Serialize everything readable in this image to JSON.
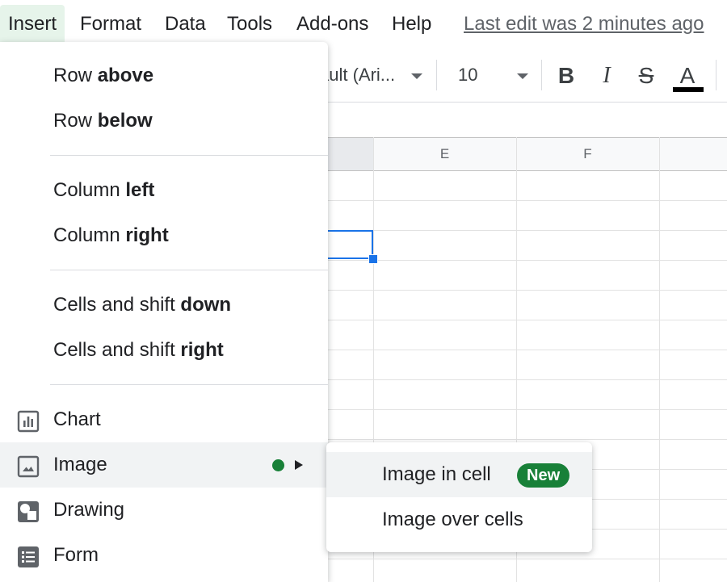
{
  "menubar": {
    "items": [
      "Insert",
      "Format",
      "Data",
      "Tools",
      "Add-ons",
      "Help"
    ],
    "last_edit": "Last edit was 2 minutes ago"
  },
  "toolbar": {
    "font": "ault (Ari...",
    "size": "10",
    "bold": "B",
    "italic": "I",
    "strike": "S",
    "text_color": "A"
  },
  "grid": {
    "columns": [
      "E",
      "F"
    ]
  },
  "insert_menu": {
    "row_above": {
      "prefix": "Row ",
      "bold": "above"
    },
    "row_below": {
      "prefix": "Row ",
      "bold": "below"
    },
    "column_left": {
      "prefix": "Column ",
      "bold": "left"
    },
    "column_right": {
      "prefix": "Column ",
      "bold": "right"
    },
    "cells_down": {
      "prefix": "Cells and shift ",
      "bold": "down"
    },
    "cells_right": {
      "prefix": "Cells and shift ",
      "bold": "right"
    },
    "chart": "Chart",
    "image": "Image",
    "drawing": "Drawing",
    "form": "Form"
  },
  "image_submenu": {
    "image_in_cell": "Image in cell",
    "new_badge": "New",
    "image_over_cells": "Image over cells"
  },
  "icons": {
    "chart": "chart-icon",
    "image": "image-icon",
    "drawing": "drawing-icon",
    "form": "form-icon",
    "submenu": "submenu-arrow-icon"
  },
  "colors": {
    "accent": "#1a73e8",
    "new_badge": "#188038",
    "menu_active": "#e6f4ea"
  }
}
